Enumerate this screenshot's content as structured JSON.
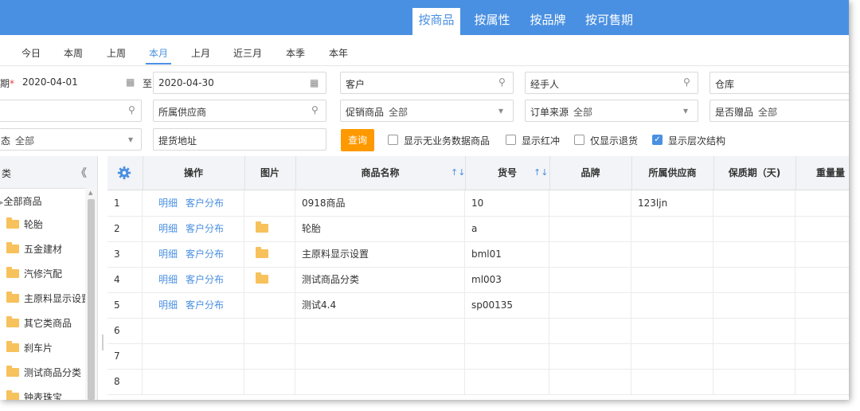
{
  "top_tabs": [
    {
      "label": "按商品",
      "active": true
    },
    {
      "label": "按属性"
    },
    {
      "label": "按品牌"
    },
    {
      "label": "按可售期"
    }
  ],
  "date_tabs": [
    "今日",
    "本周",
    "上周",
    "本月",
    "上月",
    "近三月",
    "本季",
    "本年"
  ],
  "active_date_tab": "本月",
  "filters": {
    "date_label": "期",
    "date_required_mark": "*",
    "date_from": "2020-04-01",
    "date_sep": "至",
    "date_to": "2020-04-30",
    "customer": "客户",
    "handler": "经手人",
    "warehouse": "仓库",
    "supplier": "所属供应商",
    "promo_label": "促销商品",
    "promo_value": "全部",
    "order_source_label": "订单来源",
    "order_source_value": "全部",
    "gift_label": "是否赠品",
    "gift_value": "全部",
    "status_label": "态",
    "status_value": "全部",
    "address": "提货地址",
    "query_button": "查询"
  },
  "checkboxes": [
    {
      "label": "显示无业务数据商品",
      "checked": false
    },
    {
      "label": "显示红冲",
      "checked": false
    },
    {
      "label": "仅显示退货",
      "checked": false
    },
    {
      "label": "显示层次结构",
      "checked": true
    }
  ],
  "sidebar": {
    "header": "类",
    "collapse_glyph": "《",
    "root": "全部商品",
    "items": [
      "轮胎",
      "五金建材",
      "汽修汽配",
      "主原料显示设置",
      "其它类商品",
      "刹车片",
      "测试商品分类",
      "钟表珠宝"
    ]
  },
  "grid": {
    "columns": [
      "操作",
      "图片",
      "商品名称",
      "货号",
      "品牌",
      "所属供应商",
      "保质期（天)",
      "重量量"
    ],
    "sort_glyph": "↑↓",
    "row_links": [
      "明细",
      "客户分布"
    ],
    "rows": [
      {
        "no": "1",
        "name": "0918商品",
        "code": "10",
        "supplier": "123ljn",
        "img": false
      },
      {
        "no": "2",
        "name": "轮胎",
        "code": "a",
        "supplier": "",
        "img": true
      },
      {
        "no": "3",
        "name": "主原料显示设置",
        "code": "bml01",
        "supplier": "",
        "img": true
      },
      {
        "no": "4",
        "name": "测试商品分类",
        "code": "ml003",
        "supplier": "",
        "img": true
      },
      {
        "no": "5",
        "name": "测试4.4",
        "code": "sp00135",
        "supplier": "",
        "img": false
      },
      {
        "no": "6",
        "name": "",
        "code": "",
        "supplier": "",
        "img": false
      },
      {
        "no": "7",
        "name": "",
        "code": "",
        "supplier": "",
        "img": false
      },
      {
        "no": "8",
        "name": "",
        "code": "",
        "supplier": "",
        "img": false
      }
    ]
  },
  "colors": {
    "accent": "#4a90e2",
    "query_button": "#ff9900",
    "folder": "#f7c15c"
  }
}
